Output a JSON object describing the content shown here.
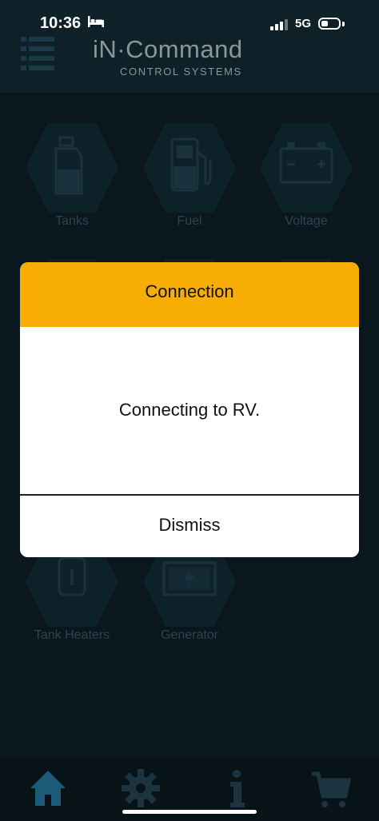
{
  "status_bar": {
    "time": "10:36",
    "network": "5G"
  },
  "header": {
    "logo_title": "iN·Command",
    "logo_subtitle": "CONTROL SYSTEMS"
  },
  "tiles": [
    {
      "label": "Tanks",
      "icon": "tank-icon"
    },
    {
      "label": "Fuel",
      "icon": "fuel-pump-icon"
    },
    {
      "label": "Voltage",
      "icon": "battery-icon"
    },
    {
      "label": "Tank Heaters",
      "icon": "heater-icon"
    },
    {
      "label": "Generator",
      "icon": "generator-icon"
    }
  ],
  "dialog": {
    "title": "Connection",
    "message": "Connecting to RV.",
    "dismiss_label": "Dismiss"
  },
  "tabbar": {
    "items": [
      {
        "icon": "home-icon",
        "active": true
      },
      {
        "icon": "gear-icon",
        "active": false
      },
      {
        "icon": "info-icon",
        "active": false
      },
      {
        "icon": "cart-icon",
        "active": false
      }
    ]
  },
  "colors": {
    "background": "#0b1a22",
    "dialog_header": "#f7ad04",
    "dialog_body": "#ffffff",
    "active_tab": "#1d5a78",
    "inactive": "#1c3440"
  }
}
